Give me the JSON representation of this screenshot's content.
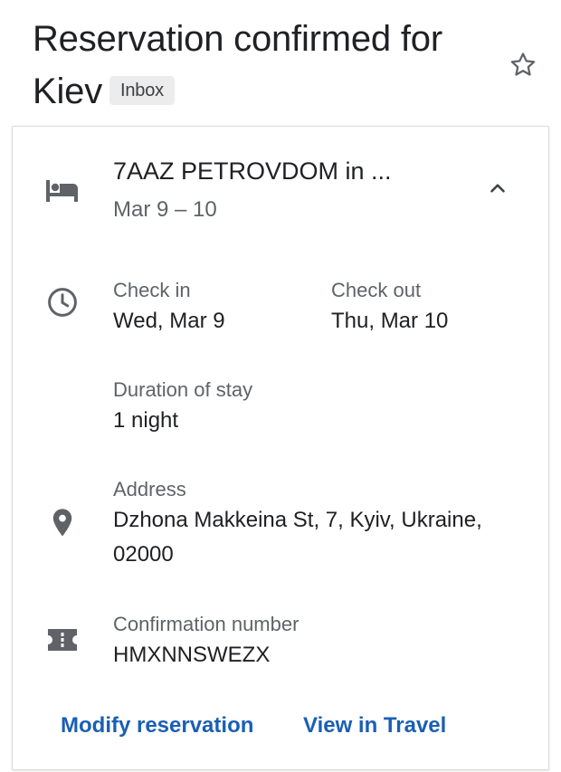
{
  "email": {
    "subject": "Reservation confirmed for Kiev",
    "label": "Inbox"
  },
  "card": {
    "hotel_name": "7AAZ PETROVDOM in ...",
    "dates": "Mar 9 – 10",
    "check_in_label": "Check in",
    "check_in_value": "Wed, Mar 9",
    "check_out_label": "Check out",
    "check_out_value": "Thu, Mar 10",
    "duration_label": "Duration of stay",
    "duration_value": "1 night",
    "address_label": "Address",
    "address_line1": "Dzhona Makkeina St, 7, Kyiv, Ukraine,",
    "address_line2": "02000",
    "confirmation_label": "Confirmation number",
    "confirmation_value": "HMXNNSWEZX"
  },
  "actions": {
    "modify": "Modify reservation",
    "view": "View in Travel"
  },
  "icons": {
    "star": "star-outline-icon",
    "hotel": "hotel-bed-icon",
    "chevron": "chevron-up-icon",
    "clock": "clock-icon",
    "place": "location-pin-icon",
    "ticket": "ticket-icon"
  },
  "colors": {
    "link": "#1a5fb4",
    "icon": "#5f6368",
    "text": "#202124",
    "chip_bg": "#ececec"
  }
}
